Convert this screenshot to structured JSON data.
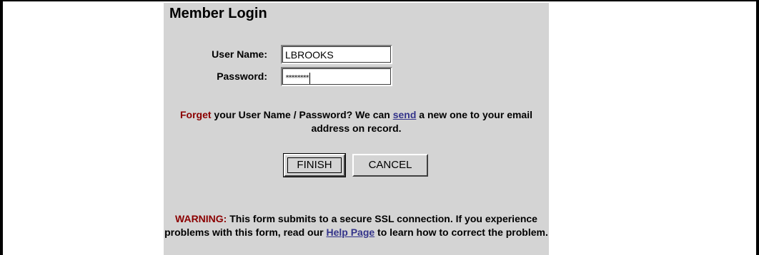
{
  "login": {
    "title": "Member Login",
    "username_label": "User Name:",
    "username_value": "LBROOKS",
    "password_label": "Password:",
    "password_value": "********"
  },
  "forget": {
    "prefix": "Forget",
    "text_a": " your User Name / Password? We can ",
    "link": "send",
    "text_b": " a new one to your email address on record."
  },
  "buttons": {
    "finish": "FINISH",
    "cancel": "CANCEL"
  },
  "warning": {
    "label": "WARNING:",
    "text_a": " This form submits to a secure SSL connection. If you experience problems with this form, read our ",
    "link": "Help Page",
    "text_b": " to learn how to correct the problem."
  },
  "colors": {
    "panel_bg": "#d4d4d4",
    "warning_red": "#8b0000",
    "link_blue": "#33338a"
  }
}
